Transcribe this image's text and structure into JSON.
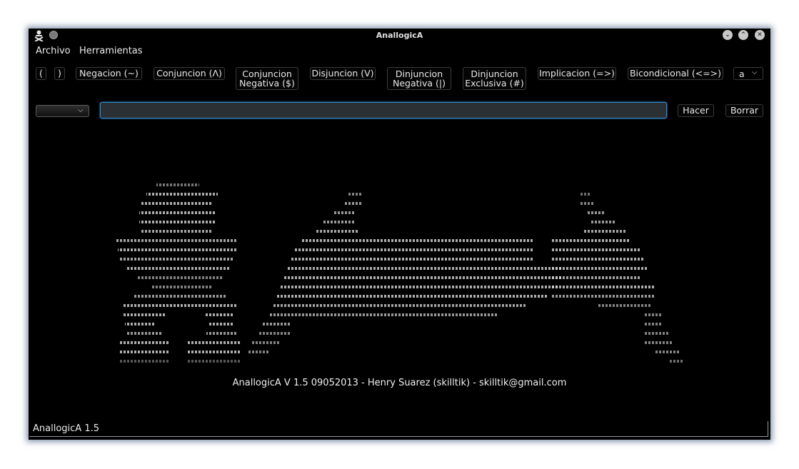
{
  "window": {
    "title": "AnallogicA"
  },
  "titlebar": {
    "icons": [
      "app-icon",
      "minimize-icon",
      "maximize-icon",
      "close-icon"
    ]
  },
  "menu": {
    "items": [
      "Archivo",
      "Herramientas"
    ]
  },
  "toolbar": {
    "buttons": [
      {
        "label": "("
      },
      {
        "label": ")"
      },
      {
        "label": "Negacion (~)"
      },
      {
        "label": "Conjuncion (Λ)"
      },
      {
        "line1": "Conjuncion",
        "line2": "Negativa ($)"
      },
      {
        "label": "Disjuncion (V)"
      },
      {
        "line1": "Dinjuncion",
        "line2": "Negativa (|)"
      },
      {
        "line1": "Dinjuncion",
        "line2": "Exclusiva (#)"
      },
      {
        "label": "Implicacion (=>)"
      },
      {
        "label": "Bicondicional (<=>)"
      }
    ],
    "variable_select": "a"
  },
  "input_row": {
    "combo_value": "",
    "formula_value": "",
    "hacer_label": "Hacer",
    "borrar_label": "Borrar"
  },
  "canvas": {
    "credits": "AnallogicA V 1.5 09052013 - Henry Suarez (skilltik) - skilltik@gmail.com"
  },
  "status": {
    "text": "AnallogicA 1.5"
  },
  "colors": {
    "background": "#000000",
    "text": "#e8e8e8",
    "input_border": "#2f8ccc",
    "input_fill": "#2b3035"
  }
}
